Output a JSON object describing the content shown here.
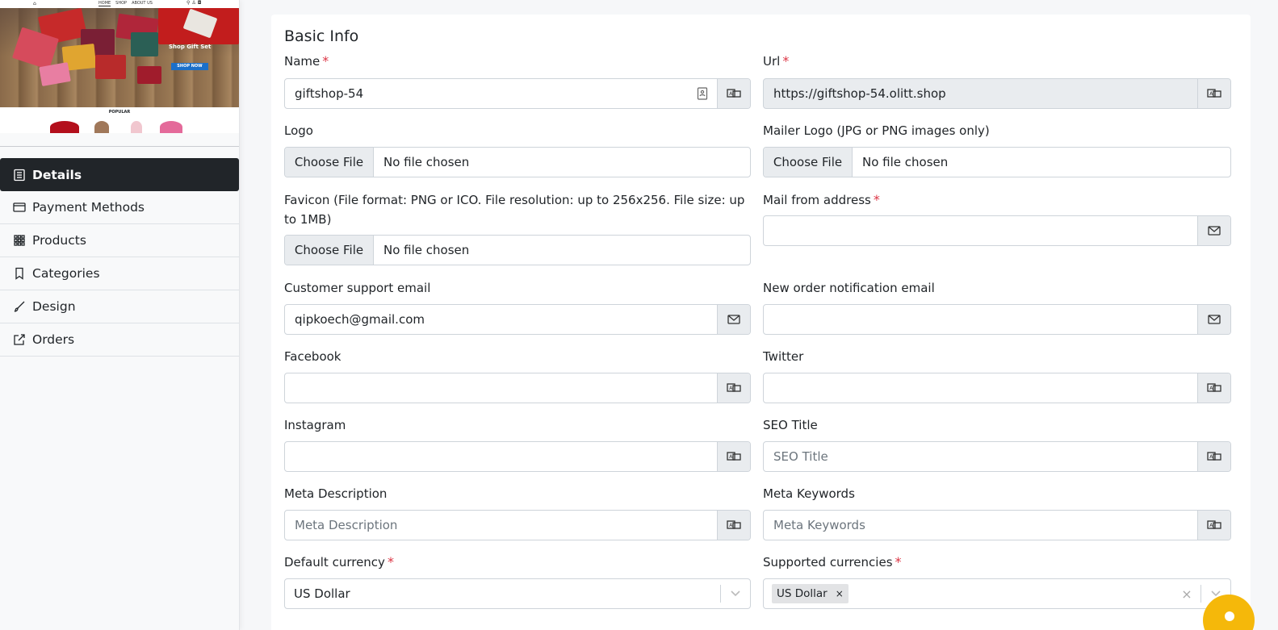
{
  "preview": {
    "nav_links": [
      "HOME",
      "SHOP",
      "ABOUT US"
    ],
    "hero_tag": "Shop Gift Set",
    "hero_button": "SHOP NOW",
    "popular_label": "POPULAR"
  },
  "sidebar": {
    "items": [
      {
        "label": "Details",
        "icon": "list-icon",
        "active": true
      },
      {
        "label": "Payment Methods",
        "icon": "card-icon",
        "active": false
      },
      {
        "label": "Products",
        "icon": "grid-icon",
        "active": false
      },
      {
        "label": "Categories",
        "icon": "bookmark-icon",
        "active": false
      },
      {
        "label": "Design",
        "icon": "brush-icon",
        "active": false
      },
      {
        "label": "Orders",
        "icon": "external-link-icon",
        "active": false
      }
    ]
  },
  "form": {
    "title": "Basic Info",
    "name": {
      "label": "Name",
      "value": "giftshop-54"
    },
    "url": {
      "label": "Url",
      "value": "https://giftshop-54.olitt.shop"
    },
    "logo": {
      "label": "Logo",
      "button": "Choose File",
      "status": "No file chosen"
    },
    "mailer_logo": {
      "label": "Mailer Logo (JPG or PNG images only)",
      "button": "Choose File",
      "status": "No file chosen"
    },
    "favicon": {
      "label": "Favicon (File format: PNG or ICO. File resolution: up to 256x256. File size: up to 1MB)",
      "button": "Choose File",
      "status": "No file chosen"
    },
    "mail_from": {
      "label": "Mail from address",
      "value": ""
    },
    "support_email": {
      "label": "Customer support email",
      "value": "qipkoech@gmail.com"
    },
    "order_email": {
      "label": "New order notification email",
      "value": ""
    },
    "facebook": {
      "label": "Facebook",
      "value": ""
    },
    "twitter": {
      "label": "Twitter",
      "value": ""
    },
    "instagram": {
      "label": "Instagram",
      "value": ""
    },
    "seo_title": {
      "label": "SEO Title",
      "placeholder": "SEO Title"
    },
    "meta_description": {
      "label": "Meta Description",
      "placeholder": "Meta Description"
    },
    "meta_keywords": {
      "label": "Meta Keywords",
      "placeholder": "Meta Keywords"
    },
    "default_currency": {
      "label": "Default currency",
      "value": "US Dollar"
    },
    "supported_currencies": {
      "label": "Supported currencies",
      "chips": [
        "US Dollar"
      ],
      "chip_remove": "×",
      "clear": "×"
    }
  },
  "colors": {
    "accent_dark": "#212529",
    "required": "#dc3545",
    "fab": "#f5b80a"
  }
}
